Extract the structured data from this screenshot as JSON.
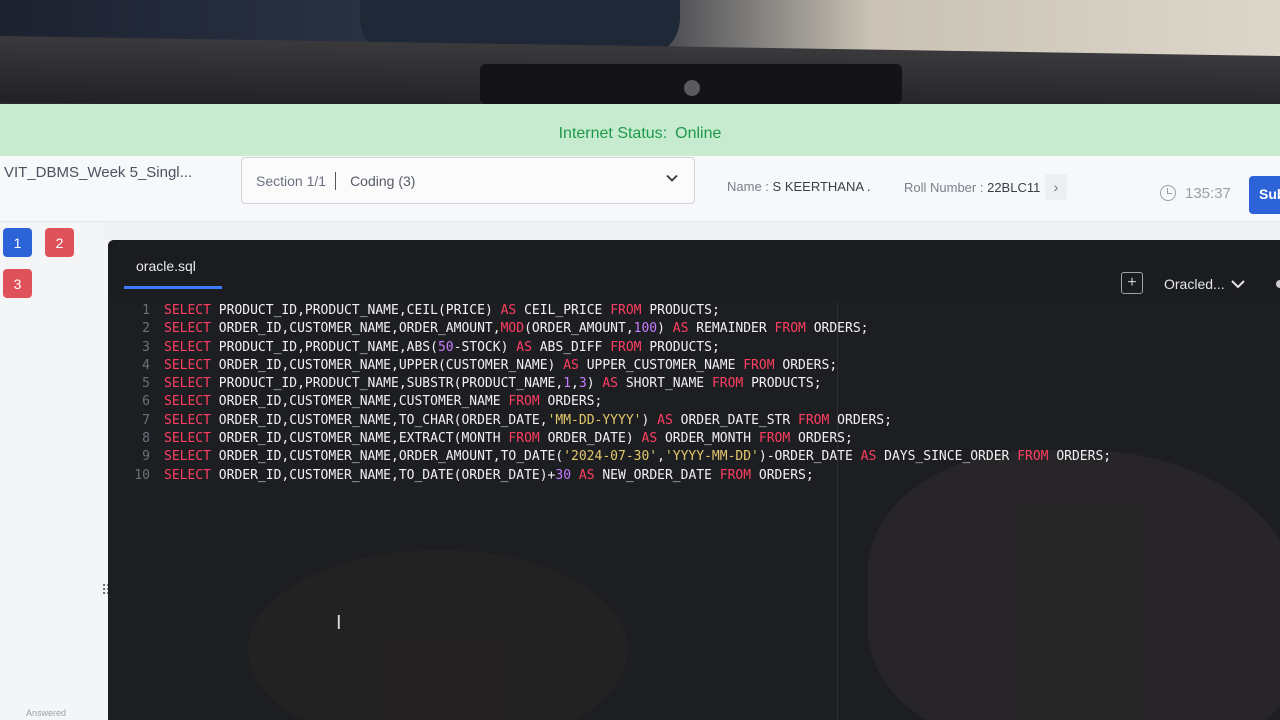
{
  "status": {
    "label": "Internet Status:",
    "value": "Online"
  },
  "header": {
    "test_title": "VIT_DBMS_Week 5_Singl...",
    "section": "Section 1/1",
    "category": "Coding (3)",
    "name_label": "Name :",
    "name_value": "S KEERTHANA .",
    "roll_label": "Roll Number :",
    "roll_value": "22BLC11",
    "timer": "135:37",
    "submit_label": "Sub"
  },
  "questions": [
    {
      "label": "1",
      "color": "#2d63d8"
    },
    {
      "label": "2",
      "color": "#e0525a"
    },
    {
      "label": "3",
      "color": "#e0525a"
    }
  ],
  "answered_label": "Answered",
  "editor": {
    "file_tab": "oracle.sql",
    "language": "Oracled...",
    "add_icon": "plus-square-icon",
    "lines": [
      {
        "n": "1",
        "code": "SELECT PRODUCT_ID,PRODUCT_NAME,CEIL(PRICE) AS CEIL_PRICE FROM PRODUCTS;"
      },
      {
        "n": "2",
        "code": "SELECT ORDER_ID,CUSTOMER_NAME,ORDER_AMOUNT,MOD(ORDER_AMOUNT,100) AS REMAINDER FROM ORDERS;"
      },
      {
        "n": "3",
        "code": "SELECT PRODUCT_ID,PRODUCT_NAME,ABS(50-STOCK) AS ABS_DIFF FROM PRODUCTS;"
      },
      {
        "n": "4",
        "code": "SELECT ORDER_ID,CUSTOMER_NAME,UPPER(CUSTOMER_NAME) AS UPPER_CUSTOMER_NAME FROM ORDERS;"
      },
      {
        "n": "5",
        "code": "SELECT PRODUCT_ID,PRODUCT_NAME,SUBSTR(PRODUCT_NAME,1,3) AS SHORT_NAME FROM PRODUCTS;"
      },
      {
        "n": "6",
        "code": "SELECT ORDER_ID,CUSTOMER_NAME,CUSTOMER_NAME FROM ORDERS;"
      },
      {
        "n": "7",
        "code": "SELECT ORDER_ID,CUSTOMER_NAME,TO_CHAR(ORDER_DATE,'MM-DD-YYYY') AS ORDER_DATE_STR FROM ORDERS;"
      },
      {
        "n": "8",
        "code": "SELECT ORDER_ID,CUSTOMER_NAME,EXTRACT(MONTH FROM ORDER_DATE) AS ORDER_MONTH FROM ORDERS;"
      },
      {
        "n": "9",
        "code": "SELECT ORDER_ID,CUSTOMER_NAME,ORDER_AMOUNT,TO_DATE('2024-07-30','YYYY-MM-DD')-ORDER_DATE AS DAYS_SINCE_ORDER FROM ORDERS;"
      },
      {
        "n": "10",
        "code": "SELECT ORDER_ID,CUSTOMER_NAME,TO_DATE(ORDER_DATE)+30 AS NEW_ORDER_DATE FROM ORDERS;"
      }
    ]
  },
  "colors": {
    "keyword": "#ff3e61",
    "string": "#e2c86a",
    "number": "#c77dff",
    "status_text": "#1f9a4d",
    "submit": "#2d63d8"
  }
}
